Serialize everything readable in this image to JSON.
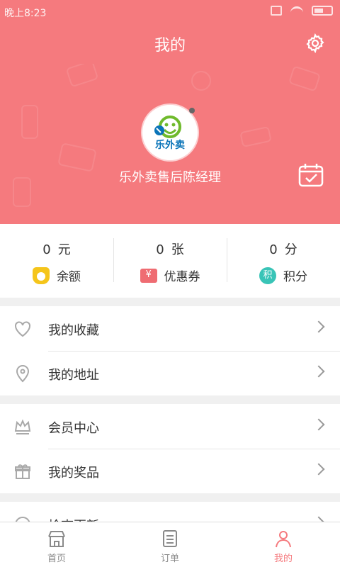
{
  "status_bar": {
    "time": "晚上8:23"
  },
  "header": {
    "title": "我的"
  },
  "profile": {
    "name": "乐外卖售后陈经理",
    "logo_text": "乐外卖"
  },
  "stats": [
    {
      "value": "0",
      "unit": "元",
      "label": "余额",
      "icon": "money-bag-icon",
      "color": "#f5c51b"
    },
    {
      "value": "0",
      "unit": "张",
      "label": "优惠券",
      "icon": "coupon-icon",
      "color": "#ef6c72"
    },
    {
      "value": "0",
      "unit": "分",
      "label": "积分",
      "icon": "points-icon",
      "color": "#39c4b7",
      "icon_text": "积"
    }
  ],
  "menu": {
    "group1": [
      {
        "label": "我的收藏",
        "icon": "heart-icon"
      },
      {
        "label": "我的地址",
        "icon": "location-icon"
      }
    ],
    "group2": [
      {
        "label": "会员中心",
        "icon": "crown-icon"
      },
      {
        "label": "我的奖品",
        "icon": "gift-icon"
      }
    ],
    "group3": [
      {
        "label": "检查更新",
        "icon": "update-icon"
      }
    ]
  },
  "nav": [
    {
      "label": "首页",
      "icon": "store-icon"
    },
    {
      "label": "订单",
      "icon": "order-icon"
    },
    {
      "label": "我的",
      "icon": "profile-icon",
      "active": true
    }
  ],
  "colors": {
    "primary": "#f57a7e",
    "background": "#f0f0f0",
    "text": "#333333",
    "muted": "#8a8a8a"
  }
}
